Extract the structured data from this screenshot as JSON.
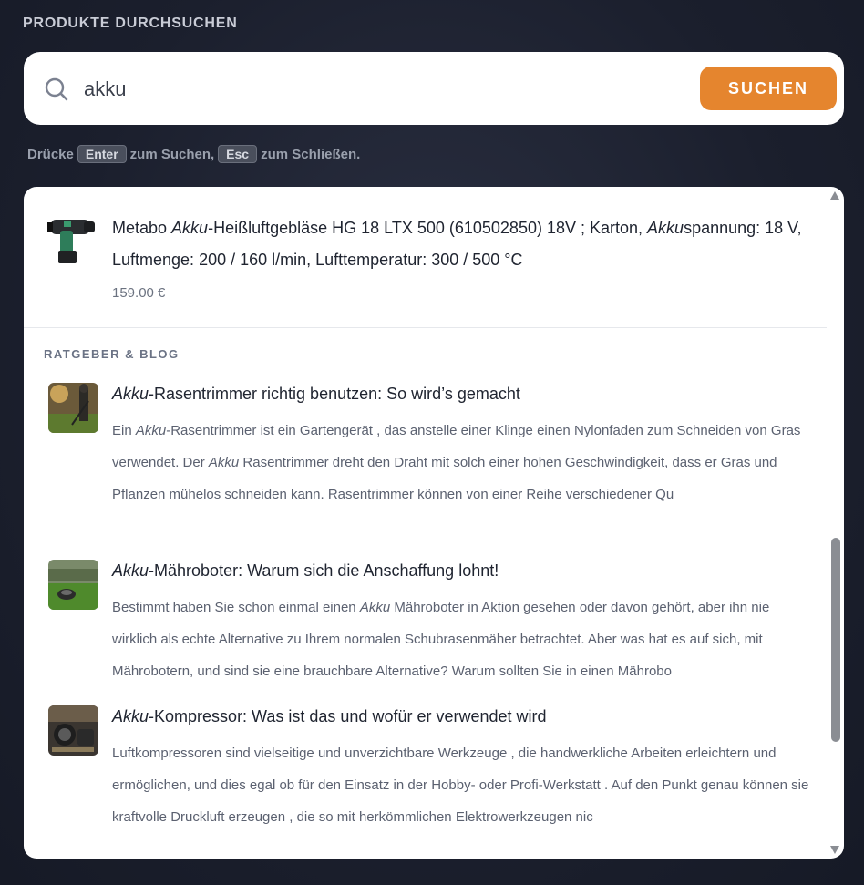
{
  "heading": "PRODUKTE DURCHSUCHEN",
  "search": {
    "value": "akku",
    "icon": "search-icon",
    "button_label": "SUCHEN"
  },
  "hint": {
    "prefix": "Drücke",
    "enter": "Enter",
    "middle": "zum Suchen,",
    "esc": "Esc",
    "suffix": "zum Schließen."
  },
  "product": {
    "title_parts": [
      "Metabo ",
      "Akku",
      "-Heißluftgebläse HG 18 LTX 500 (610502850) 18V ; Karton, ",
      "Akku",
      "spannung: 18 V, Luftmenge: 200 / 160 l/min, Lufttemperatur: 300 / 500 °C"
    ],
    "price": "159.00 €"
  },
  "section_label": "RATGEBER & BLOG",
  "blogs": [
    {
      "title_em": "Akku",
      "title_rest": "-Rasentrimmer richtig benutzen: So wird’s gemacht",
      "excerpt_parts": [
        "Ein ",
        "Akku",
        "-Rasentrimmer ist ein Gartengerät , das anstelle einer Klinge einen Nylonfaden zum Schneiden von Gras verwendet. Der ",
        "Akku",
        " Rasentrimmer dreht den Draht mit solch einer hohen Geschwindigkeit, dass er Gras und Pflanzen mühelos schneiden kann. Rasentrimmer können von einer Reihe verschiedener Qu"
      ]
    },
    {
      "title_em": "Akku",
      "title_rest": "-Mähroboter: Warum sich die Anschaffung lohnt!",
      "excerpt_parts": [
        "Bestimmt haben Sie schon einmal einen ",
        "Akku",
        " Mähroboter in Aktion gesehen oder davon gehört, aber ihn nie wirklich als echte Alternative zu Ihrem normalen Schubrasenmäher betrachtet. Aber was hat es auf sich, mit Mährobotern, und sind sie eine brauchbare Alternative? Warum sollten Sie in einen Mährobo"
      ]
    },
    {
      "title_em": "Akku",
      "title_rest": "-Kompressor: Was ist das und wofür er verwendet wird",
      "excerpt_parts": [
        "Luftkompressoren sind vielseitige und unverzichtbare Werkzeuge , die handwerkliche Arbeiten erleichtern und ermöglichen, und dies egal ob für den Einsatz in der Hobby- oder Profi-Werkstatt . Auf den Punkt genau können sie kraftvolle Druckluft erzeugen , die so mit herkömmlichen Elektrowerkzeugen nic"
      ]
    }
  ],
  "colors": {
    "accent": "#e5852e",
    "panel": "#ffffff",
    "background": "#1b1f2d"
  }
}
